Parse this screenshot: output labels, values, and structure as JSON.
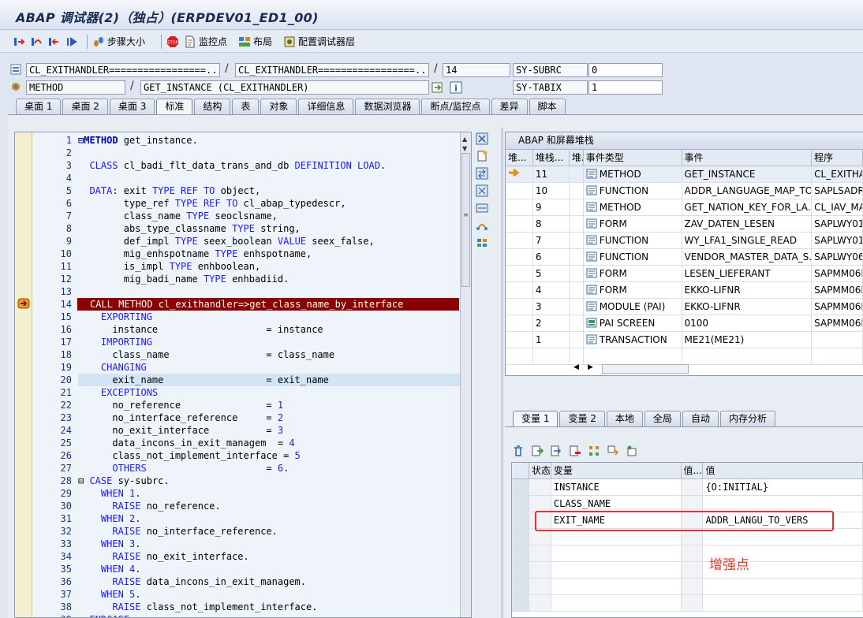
{
  "window": {
    "title": "ABAP 调试器(2)（独占）(ERPDEV01_ED1_00)"
  },
  "toolbar": {
    "step_size": "步骤大小",
    "watchpoint": "监控点",
    "layout": "布局",
    "configure": "配置调试器层"
  },
  "info": {
    "program": "CL_EXITHANDLER=================...",
    "include": "CL_EXITHANDLER=================...",
    "line": "14",
    "sy_subrc_label": "SY-SUBRC",
    "sy_subrc_value": "0",
    "event_type": "METHOD",
    "event": "GET_INSTANCE (CL_EXITHANDLER)",
    "sy_tabix_label": "SY-TABIX",
    "sy_tabix_value": "1"
  },
  "tabs": [
    "桌面 1",
    "桌面 2",
    "桌面 3",
    "标准",
    "结构",
    "表",
    "对象",
    "详细信息",
    "数据浏览器",
    "断点/监控点",
    "差异",
    "脚本"
  ],
  "active_tab": "标准",
  "code": [
    {
      "n": "1",
      "html": "<span class='kwb bold'>⊟METHOD</span> get_instance."
    },
    {
      "n": "2",
      "html": ""
    },
    {
      "n": "3",
      "html": "  <span class='kw'>CLASS</span> cl_badi_flt_data_trans_and_db <span class='kw'>DEFINITION LOAD</span>."
    },
    {
      "n": "4",
      "html": ""
    },
    {
      "n": "5",
      "html": "  <span class='kw'>DATA</span>: exit <span class='kw'>TYPE REF TO</span> object,"
    },
    {
      "n": "6",
      "html": "        type_ref <span class='kw'>TYPE REF TO</span> cl_abap_typedescr,"
    },
    {
      "n": "7",
      "html": "        class_name <span class='kw'>TYPE</span> seoclsname,"
    },
    {
      "n": "8",
      "html": "        abs_type_classname <span class='kw'>TYPE</span> string,"
    },
    {
      "n": "9",
      "html": "        def_impl <span class='kw'>TYPE</span> seex_boolean <span class='kw'>VALUE</span> seex_false,"
    },
    {
      "n": "10",
      "html": "        mig_enhspotname <span class='kw'>TYPE</span> enhspotname,"
    },
    {
      "n": "11",
      "html": "        is_impl <span class='kw'>TYPE</span> enhboolean,"
    },
    {
      "n": "12",
      "html": "        mig_badi_name <span class='kw'>TYPE</span> enhbadiid."
    },
    {
      "n": "13",
      "html": ""
    },
    {
      "n": "14",
      "html": "CALL METHOD cl_exithandler=>get_class_name_by_interface",
      "hl": true
    },
    {
      "n": "15",
      "html": "    <span class='kw'>EXPORTING</span>"
    },
    {
      "n": "16",
      "html": "      instance                   = instance"
    },
    {
      "n": "17",
      "html": "    <span class='kw'>IMPORTING</span>"
    },
    {
      "n": "18",
      "html": "      class_name                 = class_name"
    },
    {
      "n": "19",
      "html": "    <span class='kw'>CHANGING</span>"
    },
    {
      "n": "20",
      "html": "      exit_name                  = exit_name",
      "cur": true
    },
    {
      "n": "21",
      "html": "    <span class='kw'>EXCEPTIONS</span>"
    },
    {
      "n": "22",
      "html": "      no_reference               = <span class='numv'>1</span>"
    },
    {
      "n": "23",
      "html": "      no_interface_reference     = <span class='numv'>2</span>"
    },
    {
      "n": "24",
      "html": "      no_exit_interface          = <span class='numv'>3</span>"
    },
    {
      "n": "25",
      "html": "      data_incons_in_exit_managem  = <span class='numv'>4</span>"
    },
    {
      "n": "26",
      "html": "      class_not_implement_interface = <span class='numv'>5</span>"
    },
    {
      "n": "27",
      "html": "      <span class='kw'>OTHERS</span>                     = <span class='numv'>6</span>."
    },
    {
      "n": "28",
      "html": "⊟ <span class='kw'>CASE</span> sy-subrc."
    },
    {
      "n": "29",
      "html": "    <span class='kw'>WHEN</span> <span class='numv'>1</span>."
    },
    {
      "n": "30",
      "html": "      <span class='kw'>RAISE</span> no_reference."
    },
    {
      "n": "31",
      "html": "    <span class='kw'>WHEN</span> <span class='numv'>2</span>."
    },
    {
      "n": "32",
      "html": "      <span class='kw'>RAISE</span> no_interface_reference."
    },
    {
      "n": "33",
      "html": "    <span class='kw'>WHEN</span> <span class='numv'>3</span>."
    },
    {
      "n": "34",
      "html": "      <span class='kw'>RAISE</span> no_exit_interface."
    },
    {
      "n": "35",
      "html": "    <span class='kw'>WHEN</span> <span class='numv'>4</span>."
    },
    {
      "n": "36",
      "html": "      <span class='kw'>RAISE</span> data_incons_in_exit_managem."
    },
    {
      "n": "37",
      "html": "    <span class='kw'>WHEN</span> <span class='numv'>5</span>."
    },
    {
      "n": "38",
      "html": "      <span class='kw'>RAISE</span> class_not_implement_interface."
    },
    {
      "n": "39",
      "html": "  <span class='kw'>ENDCASE</span>."
    }
  ],
  "stack": {
    "title": "ABAP 和屏幕堆栈",
    "headers": [
      "堆...",
      "堆栈...",
      "堆.",
      "事件类型",
      "事件",
      "程序"
    ],
    "rows": [
      {
        "level": "11",
        "type": "METHOD",
        "event": "GET_INSTANCE",
        "program": "CL_EXITHA",
        "current": true
      },
      {
        "level": "10",
        "type": "FUNCTION",
        "event": "ADDR_LANGUAGE_MAP_TO...",
        "program": "SAPLSADR"
      },
      {
        "level": "9",
        "type": "METHOD",
        "event": "GET_NATION_KEY_FOR_LA...",
        "program": "CL_IAV_MA"
      },
      {
        "level": "8",
        "type": "FORM",
        "event": "ZAV_DATEN_LESEN",
        "program": "SAPLWY01"
      },
      {
        "level": "7",
        "type": "FUNCTION",
        "event": "WY_LFA1_SINGLE_READ",
        "program": "SAPLWY01"
      },
      {
        "level": "6",
        "type": "FUNCTION",
        "event": "VENDOR_MASTER_DATA_S...",
        "program": "SAPLWY06"
      },
      {
        "level": "5",
        "type": "FORM",
        "event": "LESEN_LIEFERANT",
        "program": "SAPMM06E"
      },
      {
        "level": "4",
        "type": "FORM",
        "event": "EKKO-LIFNR",
        "program": "SAPMM06E"
      },
      {
        "level": "3",
        "type": "MODULE (PAI)",
        "event": "EKKO-LIFNR",
        "program": "SAPMM06E"
      },
      {
        "level": "2",
        "type": "PAI SCREEN",
        "event": "0100",
        "program": "SAPMM06E"
      },
      {
        "level": "1",
        "type": "TRANSACTION",
        "event": "ME21(ME21)",
        "program": ""
      }
    ]
  },
  "var_tabs": [
    "变量 1",
    "变量 2",
    "本地",
    "全局",
    "自动",
    "内存分析"
  ],
  "vars": {
    "headers": [
      "状态",
      "变量",
      "值...",
      "值"
    ],
    "rows": [
      {
        "name": "INSTANCE",
        "value": "{O:INITIAL}"
      },
      {
        "name": "CLASS_NAME",
        "value": ""
      },
      {
        "name": "EXIT_NAME",
        "value": "ADDR_LANGU_TO_VERS"
      }
    ]
  },
  "annotation": "增强点",
  "colors": {
    "highlight_line": "#8a0000",
    "annotation": "#e03a2a"
  }
}
